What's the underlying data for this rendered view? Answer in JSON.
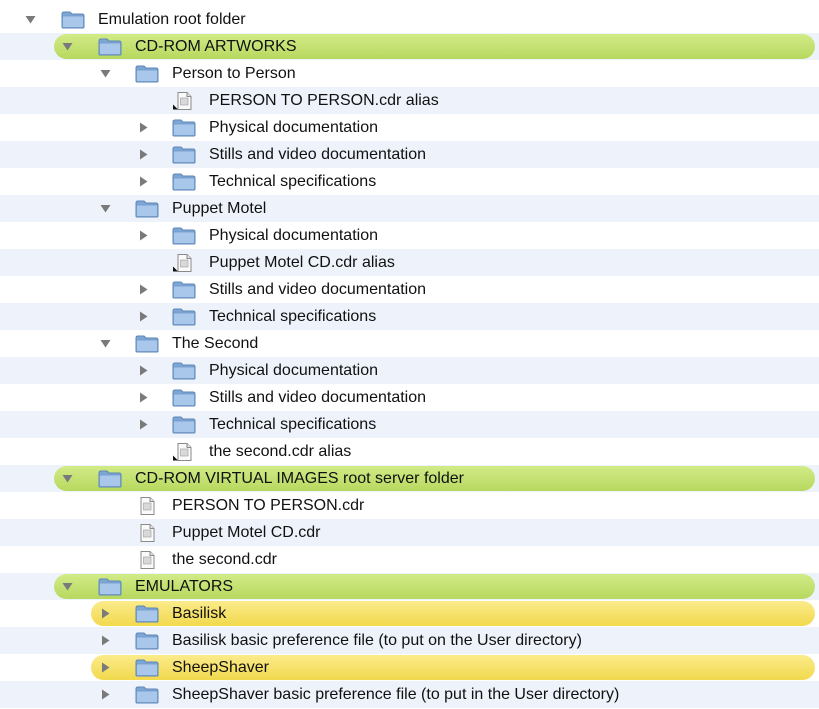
{
  "colors": {
    "green_highlight": "#c6e374",
    "yellow_highlight": "#f5e06a",
    "folder_blue": "#8bb1dc",
    "stripe": "#eef3fb"
  },
  "rows": [
    {
      "level": 0,
      "toggle": "expanded",
      "icon": "folder-icon",
      "label": "Emulation root folder",
      "highlight": "",
      "stripe": false
    },
    {
      "level": 1,
      "toggle": "expanded",
      "icon": "folder-icon",
      "label": "CD-ROM ARTWORKS",
      "highlight": "green",
      "stripe": true
    },
    {
      "level": 2,
      "toggle": "expanded",
      "icon": "folder-icon",
      "label": "Person to Person",
      "highlight": "",
      "stripe": false
    },
    {
      "level": 3,
      "toggle": "none",
      "icon": "alias-file-icon",
      "label": "PERSON TO PERSON.cdr alias",
      "highlight": "",
      "stripe": true
    },
    {
      "level": 3,
      "toggle": "collapsed",
      "icon": "folder-icon",
      "label": "Physical documentation",
      "highlight": "",
      "stripe": false
    },
    {
      "level": 3,
      "toggle": "collapsed",
      "icon": "folder-icon",
      "label": "Stills and video documentation",
      "highlight": "",
      "stripe": true
    },
    {
      "level": 3,
      "toggle": "collapsed",
      "icon": "folder-icon",
      "label": "Technical specifications",
      "highlight": "",
      "stripe": false
    },
    {
      "level": 2,
      "toggle": "expanded",
      "icon": "folder-icon",
      "label": "Puppet Motel",
      "highlight": "",
      "stripe": true
    },
    {
      "level": 3,
      "toggle": "collapsed",
      "icon": "folder-icon",
      "label": "Physical documentation",
      "highlight": "",
      "stripe": false
    },
    {
      "level": 3,
      "toggle": "none",
      "icon": "alias-file-icon",
      "label": "Puppet Motel CD.cdr alias",
      "highlight": "",
      "stripe": true
    },
    {
      "level": 3,
      "toggle": "collapsed",
      "icon": "folder-icon",
      "label": "Stills and video documentation",
      "highlight": "",
      "stripe": false
    },
    {
      "level": 3,
      "toggle": "collapsed",
      "icon": "folder-icon",
      "label": "Technical specifications",
      "highlight": "",
      "stripe": true
    },
    {
      "level": 2,
      "toggle": "expanded",
      "icon": "folder-icon",
      "label": "The Second",
      "highlight": "",
      "stripe": false
    },
    {
      "level": 3,
      "toggle": "collapsed",
      "icon": "folder-icon",
      "label": "Physical documentation",
      "highlight": "",
      "stripe": true
    },
    {
      "level": 3,
      "toggle": "collapsed",
      "icon": "folder-icon",
      "label": "Stills and video documentation",
      "highlight": "",
      "stripe": false
    },
    {
      "level": 3,
      "toggle": "collapsed",
      "icon": "folder-icon",
      "label": "Technical specifications",
      "highlight": "",
      "stripe": true
    },
    {
      "level": 3,
      "toggle": "none",
      "icon": "alias-file-icon",
      "label": "the second.cdr alias",
      "highlight": "",
      "stripe": false
    },
    {
      "level": 1,
      "toggle": "expanded",
      "icon": "folder-icon",
      "label": "CD-ROM VIRTUAL IMAGES root server folder",
      "highlight": "green",
      "stripe": true
    },
    {
      "level": 2,
      "toggle": "none",
      "icon": "file-icon",
      "label": "PERSON TO PERSON.cdr",
      "highlight": "",
      "stripe": false
    },
    {
      "level": 2,
      "toggle": "none",
      "icon": "file-icon",
      "label": "Puppet Motel CD.cdr",
      "highlight": "",
      "stripe": true
    },
    {
      "level": 2,
      "toggle": "none",
      "icon": "file-icon",
      "label": "the second.cdr",
      "highlight": "",
      "stripe": false
    },
    {
      "level": 1,
      "toggle": "expanded",
      "icon": "folder-icon",
      "label": "EMULATORS",
      "highlight": "green",
      "stripe": true
    },
    {
      "level": 2,
      "toggle": "collapsed",
      "icon": "folder-icon",
      "label": "Basilisk",
      "highlight": "yellow",
      "stripe": false
    },
    {
      "level": 2,
      "toggle": "collapsed",
      "icon": "folder-icon",
      "label": "Basilisk basic preference file (to put on the User directory)",
      "highlight": "",
      "stripe": true
    },
    {
      "level": 2,
      "toggle": "collapsed",
      "icon": "folder-icon",
      "label": "SheepShaver",
      "highlight": "yellow",
      "stripe": false
    },
    {
      "level": 2,
      "toggle": "collapsed",
      "icon": "folder-icon",
      "label": "SheepShaver basic preference file (to put in the User directory)",
      "highlight": "",
      "stripe": true
    }
  ]
}
